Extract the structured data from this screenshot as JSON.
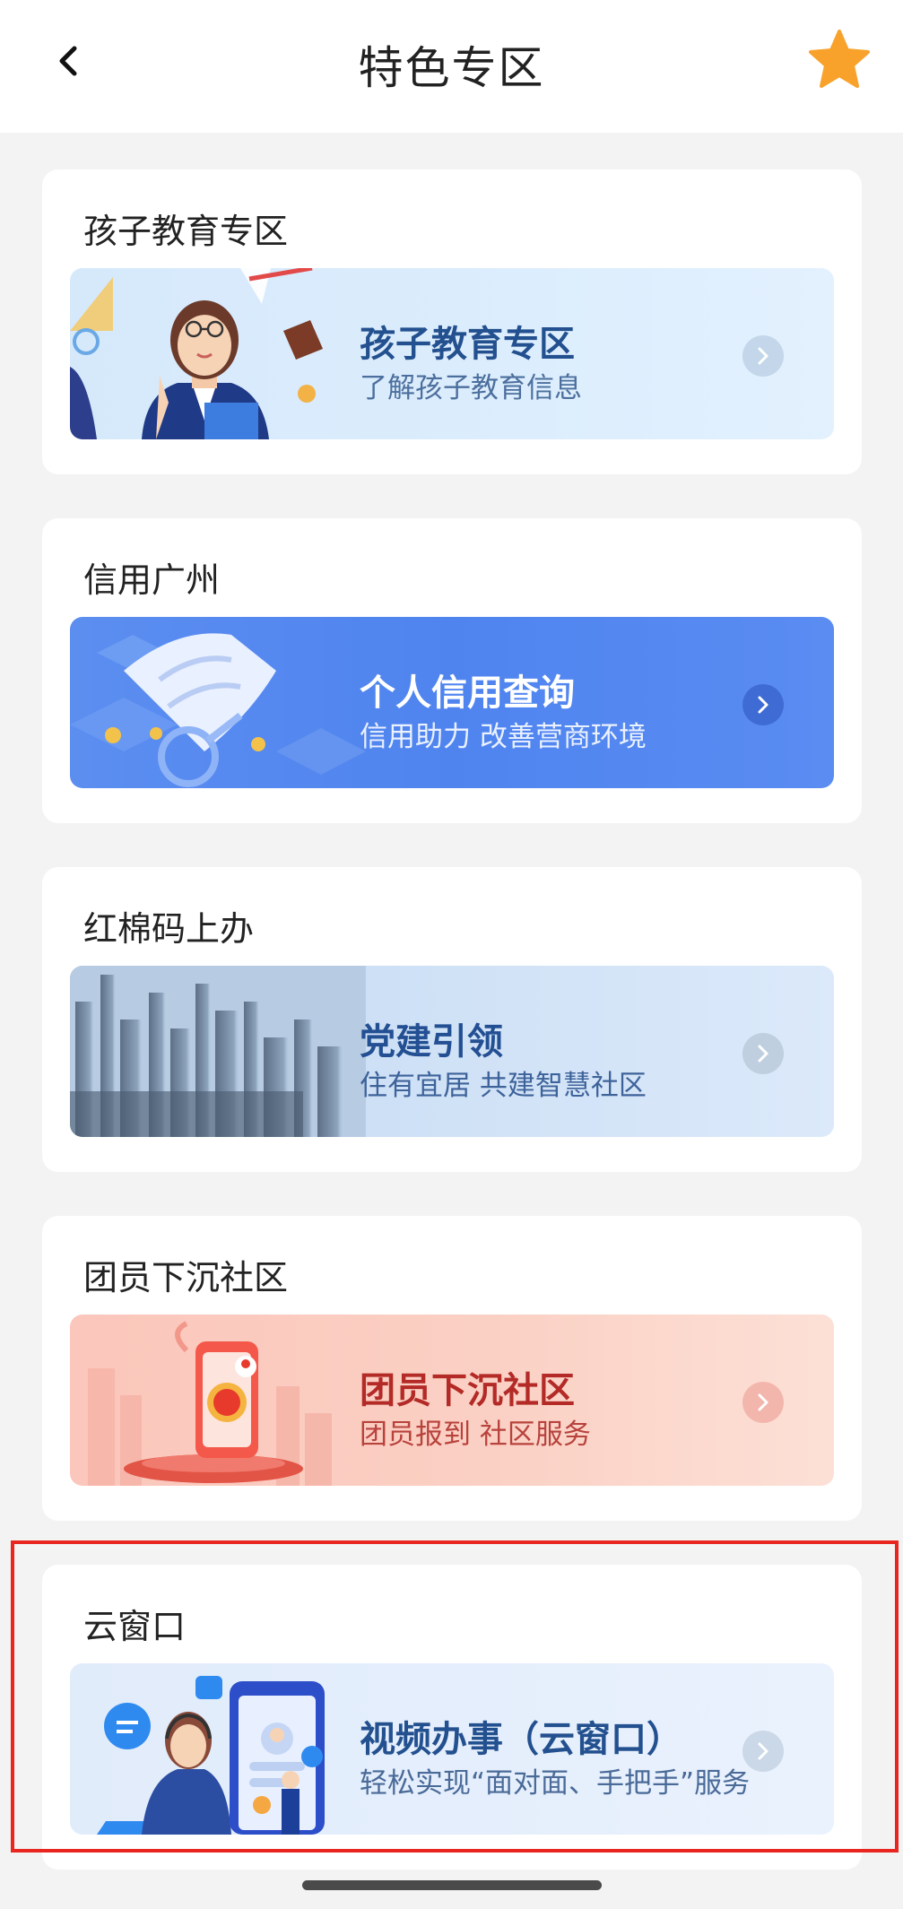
{
  "header": {
    "title": "特色专区",
    "back_icon": "chevron-left-icon",
    "favorite_icon": "star-icon",
    "favorite_color": "#f8a22c"
  },
  "cards": [
    {
      "title": "孩子教育专区",
      "banner_title": "孩子教育专区",
      "banner_subtitle": "了解孩子教育信息",
      "illustration": "teacher-illustration"
    },
    {
      "title": "信用广州",
      "banner_title": "个人信用查询",
      "banner_subtitle": "信用助力  改善营商环境",
      "illustration": "credit-document-illustration"
    },
    {
      "title": "红棉码上办",
      "banner_title": "党建引领",
      "banner_subtitle": "住有宜居  共建智慧社区",
      "illustration": "city-skyline-illustration"
    },
    {
      "title": "团员下沉社区",
      "banner_title": "团员下沉社区",
      "banner_subtitle": "团员报到 社区服务",
      "illustration": "league-phone-illustration"
    },
    {
      "title": "云窗口",
      "banner_title": "视频办事（云窗口）",
      "banner_subtitle": "轻松实现“面对面、手把手”服务",
      "illustration": "video-service-illustration"
    }
  ],
  "highlight_color": "#e8261f"
}
